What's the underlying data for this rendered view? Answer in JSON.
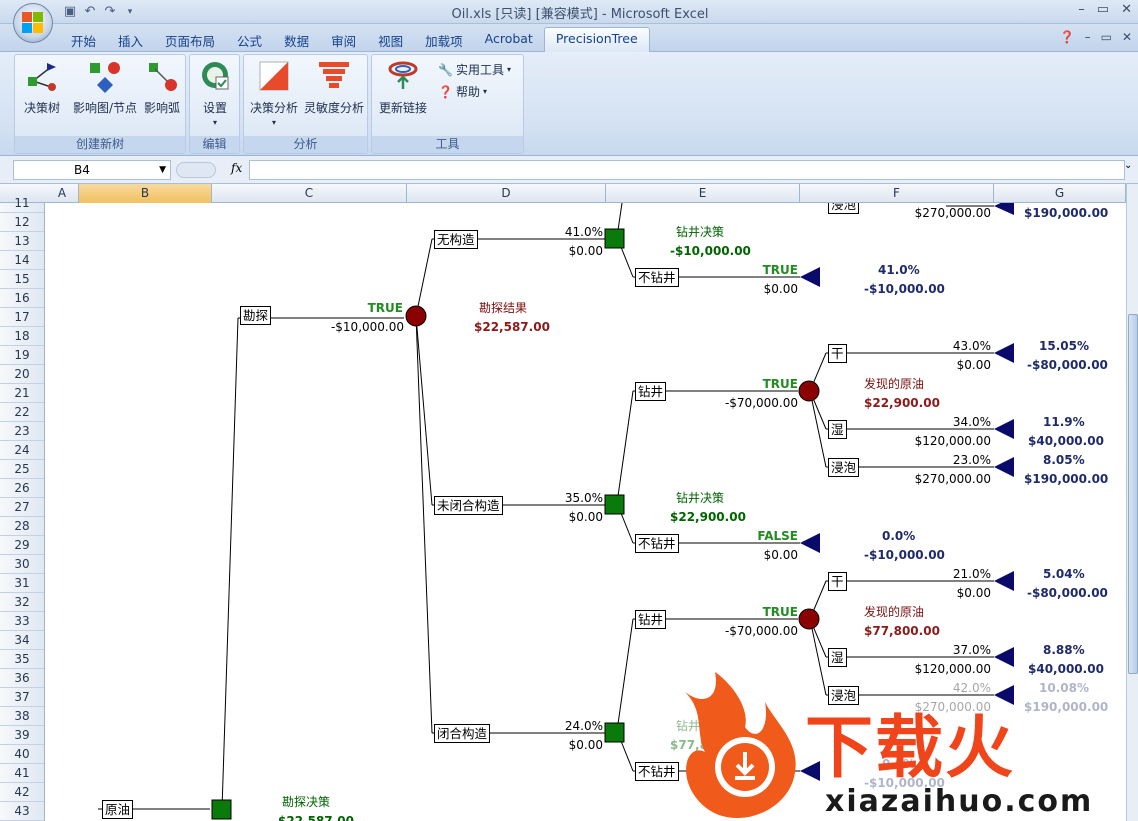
{
  "titlebar": {
    "title": "Oil.xls  [只读]  [兼容模式] - Microsoft Excel",
    "min": "–",
    "max": "▭",
    "close": "✕"
  },
  "tabs": [
    {
      "label": "开始"
    },
    {
      "label": "插入"
    },
    {
      "label": "页面布局"
    },
    {
      "label": "公式"
    },
    {
      "label": "数据"
    },
    {
      "label": "审阅"
    },
    {
      "label": "视图"
    },
    {
      "label": "加载项"
    },
    {
      "label": "Acrobat"
    },
    {
      "label": "PrecisionTree",
      "active": true
    }
  ],
  "ribbon": {
    "groups": {
      "create": "创建新树",
      "edit": "编辑",
      "analysis": "分析",
      "tools": "工具"
    },
    "buttons": {
      "decision_tree": "决策树",
      "influence_node": "影响图/节点",
      "influence_arc": "影响弧",
      "settings": "设置",
      "decision_analysis": "决策分析",
      "sensitivity": "灵敏度分析",
      "update_links": "更新链接",
      "utilities": "实用工具",
      "help": "帮助"
    }
  },
  "formula_bar": {
    "name_box": "B4",
    "fx": "fx",
    "formula": ""
  },
  "columns": [
    "A",
    "B",
    "C",
    "D",
    "E",
    "F",
    "G"
  ],
  "rows": [
    "11",
    "12",
    "13",
    "14",
    "15",
    "16",
    "17",
    "18",
    "19",
    "20",
    "21",
    "22",
    "23",
    "24",
    "25",
    "26",
    "27",
    "28",
    "29",
    "30",
    "31",
    "32",
    "33",
    "34",
    "35",
    "36",
    "37",
    "38",
    "39",
    "40",
    "41",
    "42",
    "43"
  ],
  "tree": {
    "root_label": "原油",
    "root_decision_name": "勘探决策",
    "root_decision_value": "$22,587.00",
    "explore": {
      "label": "勘探",
      "flag": "TRUE",
      "cost": "-$10,000.00"
    },
    "explore_chance_name": "勘探结果",
    "explore_chance_value": "$22,587.00",
    "no_structure": {
      "label": "无构造",
      "prob": "41.0%",
      "value": "$0.00",
      "decision_name": "钻井决策",
      "decision_value": "-$10,000.00",
      "nodrill": {
        "label": "不钻井",
        "flag": "TRUE",
        "value": "$0.00",
        "prob": "41.0%",
        "payoff": "-$10,000.00"
      }
    },
    "top_partial": {
      "label": "浸泡",
      "value": "$270,000.00",
      "payoff": "$190,000.00"
    },
    "open_structure": {
      "label": "未闭合构造",
      "prob": "35.0%",
      "value": "$0.00",
      "decision_name": "钻井决策",
      "decision_value": "$22,900.00",
      "drill": {
        "label": "钻井",
        "flag": "TRUE",
        "cost": "-$70,000.00",
        "chance_name": "发现的原油",
        "chance_value": "$22,900.00",
        "dry": {
          "label": "干",
          "prob": "43.0%",
          "value": "$0.00",
          "jprob": "15.05%",
          "payoff": "-$80,000.00"
        },
        "wet": {
          "label": "湿",
          "prob": "34.0%",
          "value": "$120,000.00",
          "jprob": "11.9%",
          "payoff": "$40,000.00"
        },
        "soak": {
          "label": "浸泡",
          "prob": "23.0%",
          "value": "$270,000.00",
          "jprob": "8.05%",
          "payoff": "$190,000.00"
        }
      },
      "nodrill": {
        "label": "不钻井",
        "flag": "FALSE",
        "value": "$0.00",
        "prob": "0.0%",
        "payoff": "-$10,000.00"
      }
    },
    "closed_structure": {
      "label": "闭合构造",
      "prob": "24.0%",
      "value": "$0.00",
      "decision_name": "钻井决策",
      "decision_value": "$77,800.00",
      "drill": {
        "label": "钻井",
        "flag": "TRUE",
        "cost": "-$70,000.00",
        "chance_name": "发现的原油",
        "chance_value": "$77,800.00",
        "dry": {
          "label": "干",
          "prob": "21.0%",
          "value": "$0.00",
          "jprob": "5.04%",
          "payoff": "-$80,000.00"
        },
        "wet": {
          "label": "湿",
          "prob": "37.0%",
          "value": "$120,000.00",
          "jprob": "8.88%",
          "payoff": "$40,000.00"
        },
        "soak": {
          "label": "浸泡",
          "prob": "42.0%",
          "value": "$270,000.00",
          "jprob": "10.08%",
          "payoff": "$190,000.00"
        }
      },
      "nodrill": {
        "label": "不钻井",
        "prob": "0.0%",
        "payoff": "-$10,000.00"
      }
    }
  },
  "watermark": {
    "title": "下载火",
    "url": "xiazaihuo.com"
  },
  "colors": {
    "decision": "#0a7a0a",
    "chance": "#8b0000",
    "terminal": "#0a0a6b",
    "accent_tab": "#15428b"
  }
}
